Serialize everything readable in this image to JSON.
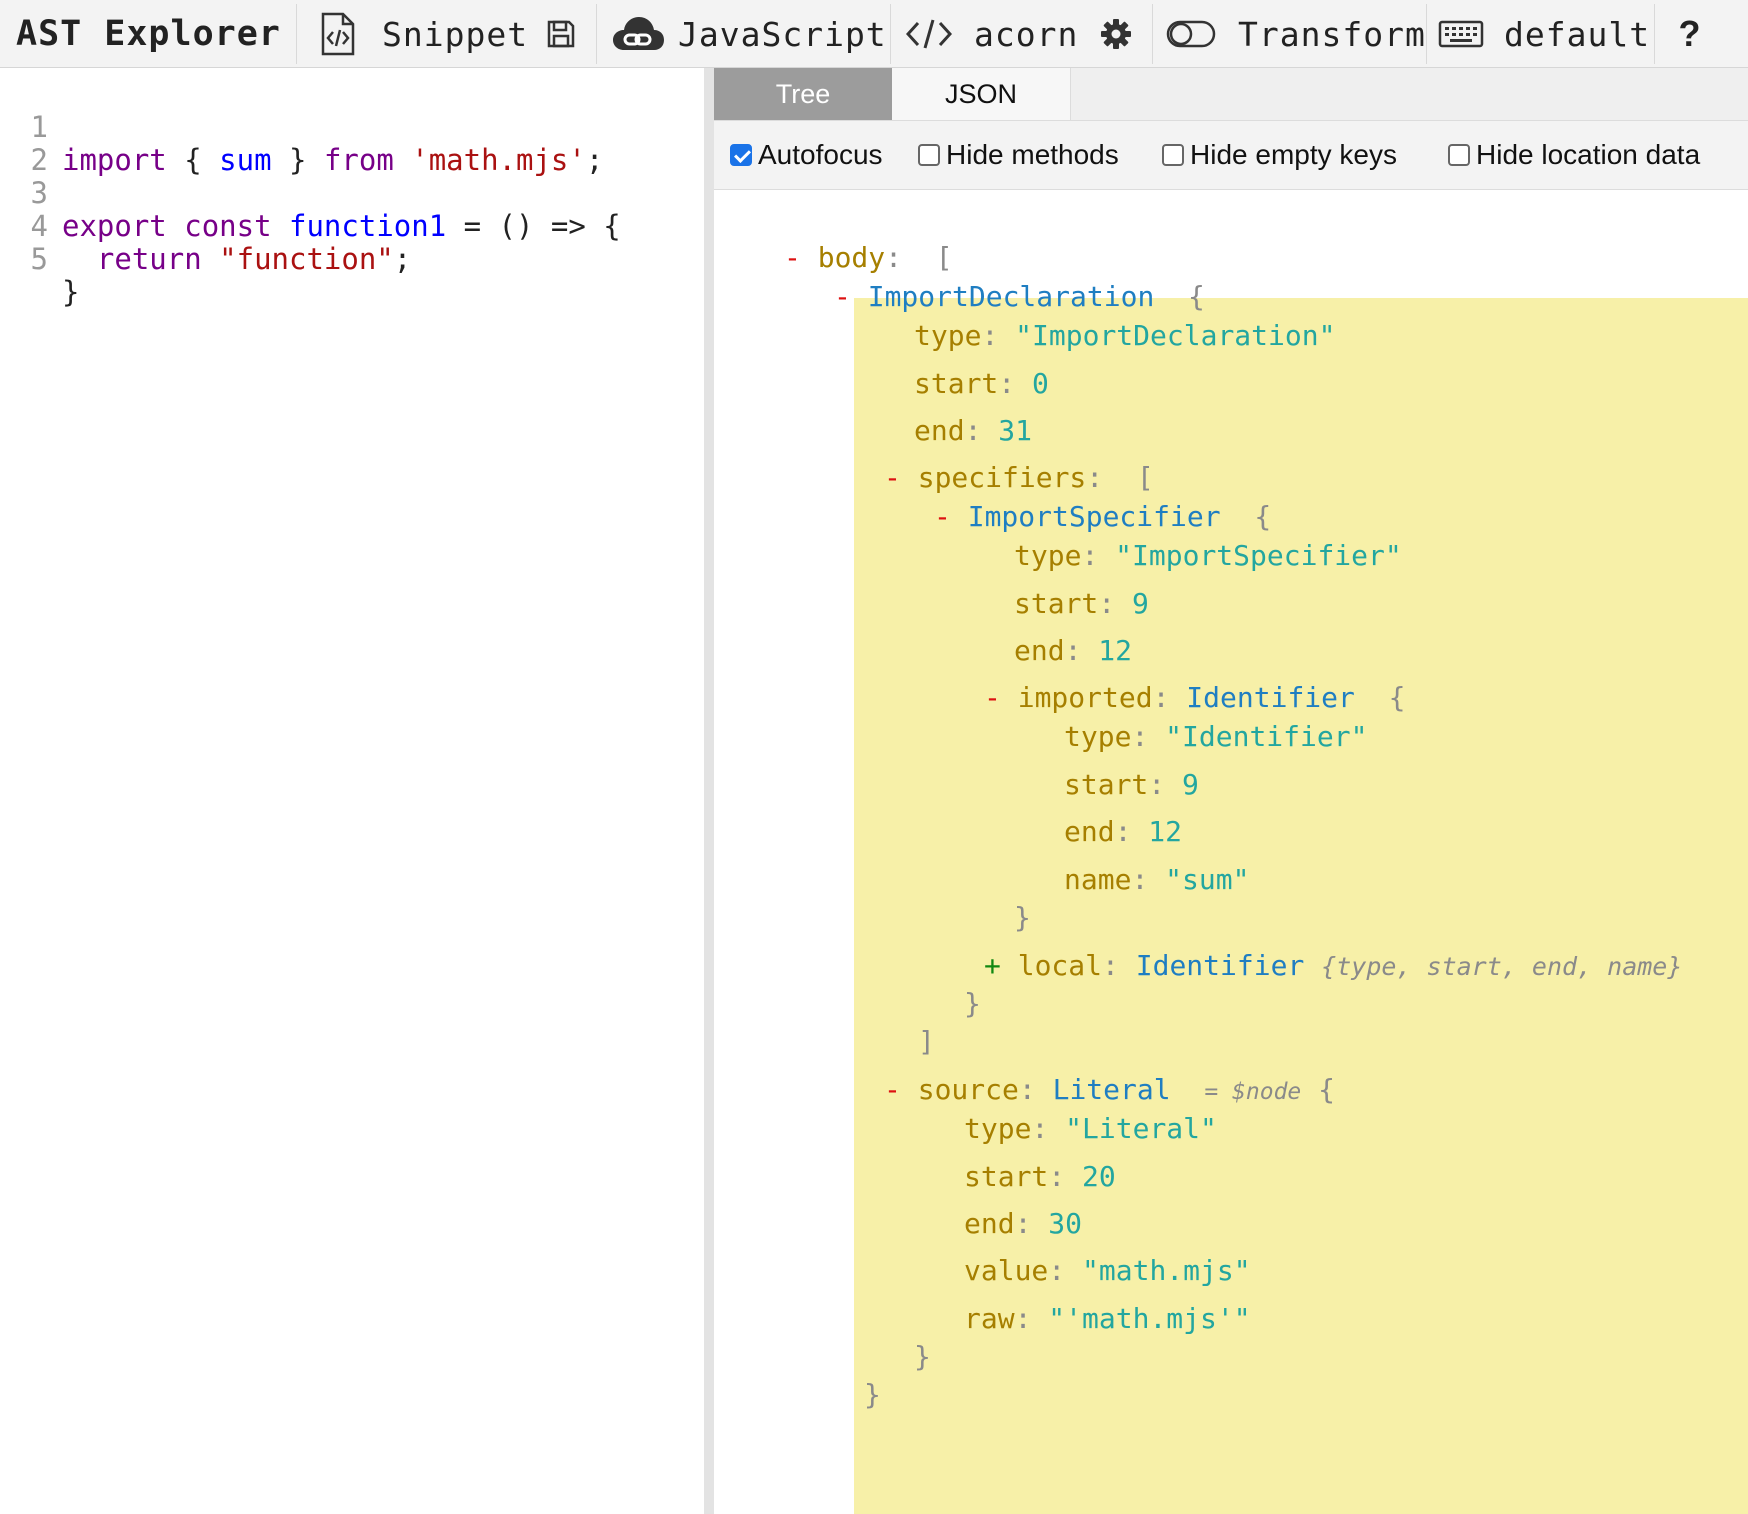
{
  "toolbar": {
    "brand": "AST Explorer",
    "snippet_label": "Snippet",
    "language_label": "JavaScript",
    "parser_label": "acorn",
    "transform_label": "Transform",
    "keymap_label": "default",
    "help_label": "?"
  },
  "editor": {
    "lines": [
      {
        "num": "1"
      },
      {
        "num": "2"
      },
      {
        "num": "3"
      },
      {
        "num": "4"
      },
      {
        "num": "5"
      }
    ],
    "tokens": {
      "l1_import": "import",
      "l1_open": " { ",
      "l1_sum": "sum",
      "l1_close": " } ",
      "l1_from": "from",
      "l1_sp": " ",
      "l1_str": "'math.mjs'",
      "l1_semi": ";",
      "l3_export": "export",
      "l3_sp1": " ",
      "l3_const": "const",
      "l3_sp2": " ",
      "l3_name": "function1",
      "l3_rest": " = () => {",
      "l4_ind": "  ",
      "l4_return": "return",
      "l4_sp": " ",
      "l4_str": "\"function\"",
      "l4_semi": ";",
      "l5_close": "}"
    }
  },
  "tabs": {
    "tree": "Tree",
    "json": "JSON"
  },
  "options": {
    "autofocus": "Autofocus",
    "hide_methods": "Hide methods",
    "hide_empty_keys": "Hide empty keys",
    "hide_location_data": "Hide location data"
  },
  "tree": {
    "minus": "-",
    "plus": "+",
    "colon": ":",
    "open_bracket": "[",
    "close_bracket": "]",
    "open_brace": "{",
    "close_brace": "}",
    "body_key": "body",
    "import_decl_type": "ImportDeclaration",
    "k_type": "type",
    "k_start": "start",
    "k_end": "end",
    "k_name": "name",
    "k_value": "value",
    "k_raw": "raw",
    "v_import_decl": "\"ImportDeclaration\"",
    "v_0": "0",
    "v_31": "31",
    "specifiers_key": "specifiers",
    "import_spec_type": "ImportSpecifier",
    "v_import_spec": "\"ImportSpecifier\"",
    "v_9": "9",
    "v_12": "12",
    "imported_key": "imported",
    "identifier_type": "Identifier",
    "v_identifier": "\"Identifier\"",
    "v_sum": "\"sum\"",
    "local_key": "local",
    "local_summary": "{type, start, end, name}",
    "source_key": "source",
    "literal_type": "Literal",
    "node_annotation": "= $node",
    "v_literal": "\"Literal\"",
    "v_20": "20",
    "v_30": "30",
    "v_math": "\"math.mjs\"",
    "v_raw": "\"'math.mjs'\""
  },
  "colors": {
    "highlight": "#f7f0a8",
    "toggle_minus": "#dd1111",
    "toggle_plus": "#118811",
    "key": "#a67f00",
    "node_type": "#1f7ec2",
    "value": "#23a6a0",
    "active_tab": "#9c9c9c"
  },
  "icons": {
    "snippet": "code-file-icon",
    "save": "floppy-disk-icon",
    "language": "cloud-link-icon",
    "parser": "code-brackets-icon",
    "settings": "gear-icon",
    "transform": "toggle-icon",
    "keymap": "keyboard-icon"
  }
}
